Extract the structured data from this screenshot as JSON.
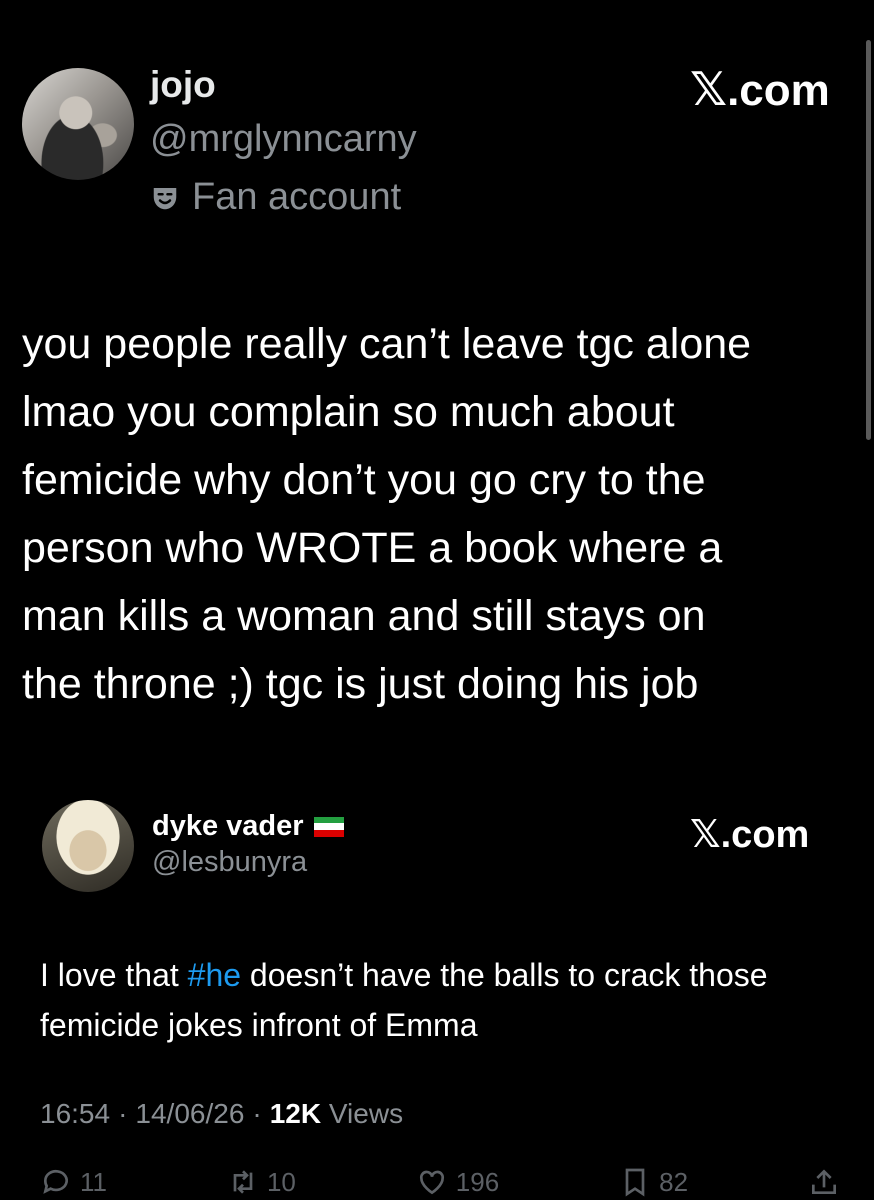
{
  "tweet": {
    "author_name": "jojo",
    "author_handle": "@mrglynncarny",
    "account_label": "Fan account",
    "source_label_suffix": ".com",
    "text": "you people really can’t leave tgc alone\nlmao you complain so much about\nfemicide why don’t you go cry to the\nperson who WROTE a book where a\nman kills a woman and still stays on\nthe throne ;) tgc is just doing his job"
  },
  "quoted": {
    "author_name": "dyke vader",
    "author_handle": "@lesbunyra",
    "source_label_suffix": ".com",
    "text_before": "I love that ",
    "hashtag": "#he",
    "text_after": " doesn’t have the balls to crack those femicide jokes infront of Emma",
    "time": "16:54",
    "date": "14/06/26",
    "views_count": "12K",
    "views_label": "Views",
    "flag_colors": [
      "#239f40",
      "#ffffff",
      "#da0000"
    ],
    "actions": {
      "replies": "11",
      "reposts": "10",
      "likes": "196",
      "bookmarks": "82"
    }
  },
  "colors": {
    "background": "#000000",
    "text": "#ffffff",
    "secondary": "#8b9095",
    "link": "#1d9bf0"
  }
}
